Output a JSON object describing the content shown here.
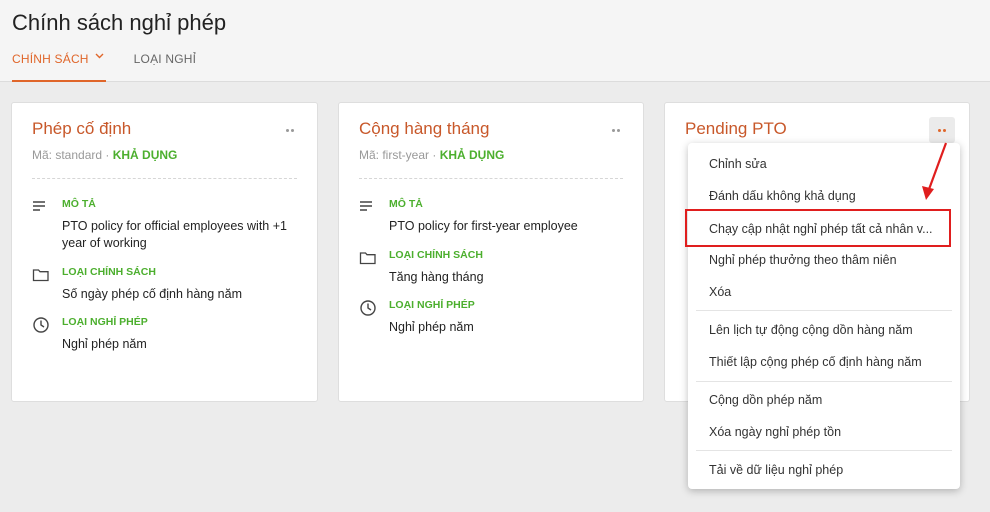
{
  "page_title": "Chính sách nghỉ phép",
  "tabs": [
    {
      "label": "CHÍNH SÁCH"
    },
    {
      "label": "LOẠI NGHỈ"
    }
  ],
  "cards": [
    {
      "title": "Phép cố định",
      "code": "Mã: standard",
      "dot_sep": " · ",
      "status": "KHẢ DỤNG",
      "desc_label": "MÔ TẢ",
      "desc_value": "PTO policy for official employees with +1 year of working",
      "policy_type_label": "LOẠI CHÍNH SÁCH",
      "policy_type_value": "Số ngày phép cố định hàng năm",
      "leave_type_label": "LOẠI NGHỈ PHÉP",
      "leave_type_value": "Nghỉ phép năm"
    },
    {
      "title": "Cộng hàng tháng",
      "code": "Mã: first-year",
      "dot_sep": " · ",
      "status": "KHẢ DỤNG",
      "desc_label": "MÔ TẢ",
      "desc_value": "PTO policy for first-year employee",
      "policy_type_label": "LOẠI CHÍNH SÁCH",
      "policy_type_value": "Tăng hàng tháng",
      "leave_type_label": "LOẠI NGHỈ PHÉP",
      "leave_type_value": "Nghỉ phép năm"
    },
    {
      "title": "Pending PTO"
    }
  ],
  "menu": {
    "items": [
      "Chỉnh sửa",
      "Đánh dấu không khả dụng",
      "Chạy cập nhật nghỉ phép tất cả nhân v...",
      "Nghỉ phép thưởng theo thâm niên",
      "Xóa",
      "Lên lịch tự động cộng dồn hàng năm",
      "Thiết lập cộng phép cố định hàng năm",
      "Cộng dồn phép năm",
      "Xóa ngày nghỉ phép tồn",
      "Tải về dữ liệu nghỉ phép"
    ]
  },
  "colors": {
    "accent": "#e0662a",
    "title": "#c8582a",
    "available": "#4caf2e",
    "highlight": "#e01e1e"
  },
  "icons": [
    "chevron-down-icon",
    "more-dots-icon",
    "lines-icon",
    "folder-icon",
    "clock-icon",
    "arrow-icon"
  ]
}
